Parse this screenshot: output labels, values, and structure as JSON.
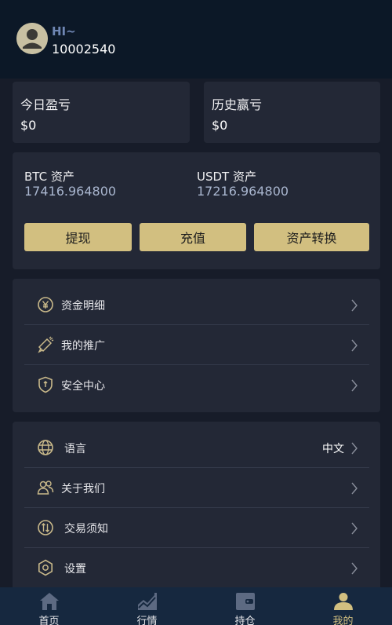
{
  "header": {
    "greeting": "HI~",
    "user_id": "10002540"
  },
  "profit": {
    "today": {
      "label": "今日盈亏",
      "value": "$0"
    },
    "history": {
      "label": "历史赢亏",
      "value": "$0"
    }
  },
  "assets": {
    "btc": {
      "label": "BTC 资产",
      "value": "17416.964800"
    },
    "usdt": {
      "label": "USDT 资产",
      "value": "17216.964800"
    },
    "buttons": {
      "withdraw": "提现",
      "deposit": "充值",
      "transfer": "资产转换"
    }
  },
  "menu1": [
    {
      "label": "资金明细",
      "icon": "yen-coin-icon"
    },
    {
      "label": "我的推广",
      "icon": "megaphone-icon"
    },
    {
      "label": "安全中心",
      "icon": "shield-icon"
    }
  ],
  "menu2": [
    {
      "label": "语言",
      "value": "中文",
      "icon": "globe-icon"
    },
    {
      "label": "关于我们",
      "icon": "users-icon"
    },
    {
      "label": "交易须知",
      "icon": "exchange-icon"
    },
    {
      "label": "设置",
      "icon": "gear-icon"
    }
  ],
  "tabbar": [
    {
      "label": "首页",
      "icon": "home-icon",
      "active": false
    },
    {
      "label": "行情",
      "icon": "market-chart-icon",
      "active": false
    },
    {
      "label": "持仓",
      "icon": "wallet-icon",
      "active": false
    },
    {
      "label": "我的",
      "icon": "user-icon",
      "active": true
    }
  ],
  "colors": {
    "background": "#171c29",
    "header": "#0c1827",
    "card": "#232836",
    "gold": "#d2bf80",
    "tabbar": "#16283f",
    "accent_blue": "#6f86b3"
  }
}
